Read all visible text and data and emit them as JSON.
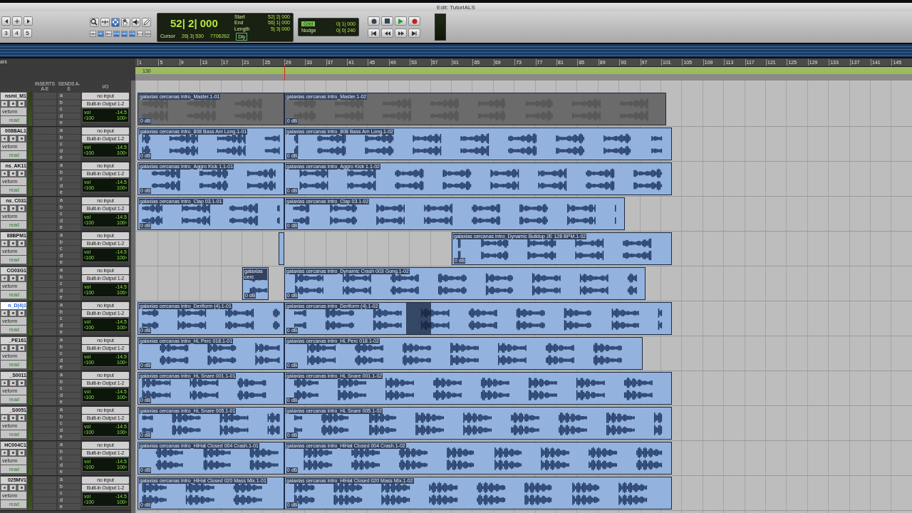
{
  "window": {
    "title": "Edit: TutorIALS"
  },
  "toolbar": {
    "zoom_presets": [
      "3",
      "4",
      "5"
    ],
    "counter": {
      "main": "52| 2| 000",
      "start_label": "Start",
      "start": "52| 2| 000",
      "end_label": "End",
      "end": "56| 1| 000",
      "length_label": "Length",
      "length": "5| 3| 000",
      "cursor_label": "Cursor",
      "cursor": "26| 3| 530",
      "sample": "7706262",
      "delay": "Dly"
    },
    "grid": {
      "grid_label": "Grid",
      "grid": "0| 1| 000",
      "nudge_label": "Nudge",
      "nudge": "0| 0| 240"
    }
  },
  "columns": {
    "inserts": "INSERTS A-E",
    "sends": "SENDS A-E",
    "io": "I/O"
  },
  "ruler": {
    "label": "ars",
    "tempo": "130",
    "bars": [
      "1",
      "5",
      "9",
      "13",
      "17",
      "21",
      "25",
      "29",
      "33",
      "37",
      "41",
      "45",
      "49",
      "53",
      "57",
      "61",
      "65",
      "69",
      "73",
      "77",
      "81",
      "85",
      "89",
      "93",
      "97",
      "101",
      "105",
      "109",
      "113",
      "117",
      "121",
      "125",
      "129",
      "133",
      "137",
      "141",
      "145"
    ]
  },
  "tracks": [
    {
      "name": "nsml_M1",
      "selected": false,
      "color": "#6b6b6b",
      "input": "no input",
      "output": "Built-in Output 1-2",
      "volume_label": "vol",
      "volume": "-14.5",
      "pan_left": "‹100",
      "pan_right": "100›",
      "view": "veform",
      "automation": "read",
      "sends": [
        "a",
        "b",
        "c",
        "d",
        "e"
      ],
      "clips": [
        {
          "name": "galaxias cercanas intro_Master.1-01",
          "gain": "0 dB"
        },
        {
          "name": "galaxias cercanas intro_Master.1-02",
          "gain": "0 dB"
        }
      ]
    },
    {
      "name": "008BAL1",
      "selected": false,
      "color": "#93b3de",
      "input": "no input",
      "output": "Built-in Output 1-2",
      "volume_label": "vol",
      "volume": "-14.5",
      "pan_left": "‹100",
      "pan_right": "100›",
      "view": "veform",
      "automation": "read",
      "sends": [
        "a",
        "b",
        "c",
        "d",
        "e"
      ],
      "clips": [
        {
          "name": "galaxias cercanas intro_808 Bass Am Long.1-01",
          "gain": "0 dB"
        },
        {
          "name": "galaxias cercanas intro_808 Bass Am Long.1-02",
          "gain": "0 dB"
        }
      ]
    },
    {
      "name": "ns_AK11",
      "selected": false,
      "color": "#93b3de",
      "input": "no input",
      "output": "Built-in Output 1-2",
      "volume_label": "vol",
      "volume": "-14.5",
      "pan_left": "‹100",
      "pan_right": "100›",
      "view": "veform",
      "automation": "read",
      "sends": [
        "a",
        "b",
        "c",
        "d",
        "e"
      ],
      "clips": [
        {
          "name": "galaxias cercanas intro_Aggro Kick 1.1-01",
          "gain": "0 dB"
        },
        {
          "name": "galaxias cercanas intro_Aggro Kick 1.1-02",
          "gain": "0 dB"
        }
      ]
    },
    {
      "name": "ns_C031",
      "selected": false,
      "color": "#93b3de",
      "input": "no input",
      "output": "Built-in Output 1-2",
      "volume_label": "vol",
      "volume": "-14.5",
      "pan_left": "‹100",
      "pan_right": "100›",
      "view": "veform",
      "automation": "read",
      "sends": [
        "a",
        "b",
        "c",
        "d",
        "e"
      ],
      "clips": [
        {
          "name": "galaxias cercanas intro_Clap 03.1-01",
          "gain": "0 dB"
        },
        {
          "name": "galaxias cercanas intro_Clap 03.1-02",
          "gain": "0 dB"
        }
      ]
    },
    {
      "name": "88BPM1",
      "selected": false,
      "color": "#93b3de",
      "input": "no input",
      "output": "Built-in Output 1-2",
      "volume_label": "vol",
      "volume": "-14.5",
      "pan_left": "‹100",
      "pan_right": "100›",
      "view": "veform",
      "automation": "read",
      "sends": [
        "a",
        "b",
        "c",
        "d",
        "e"
      ],
      "clips": [
        {
          "name": "galaxias cercanas intro_Dynamic Buildup 2E 128 BPM.1-02",
          "gain": "0 dB"
        }
      ]
    },
    {
      "name": "CO03G1",
      "selected": false,
      "color": "#93b3de",
      "input": "no input",
      "output": "Built-in Output 1-2",
      "volume_label": "vol",
      "volume": "-14.5",
      "pan_left": "‹100",
      "pan_right": "100›",
      "view": "veform",
      "automation": "read",
      "sends": [
        "a",
        "b",
        "c",
        "d",
        "e"
      ],
      "clips": [
        {
          "name": "galaxias cerc",
          "gain": "0 dB"
        },
        {
          "name": "galaxias cercanas intro_Dynamic Crash 003 Gong.1-02",
          "gain": "0 dB"
        }
      ]
    },
    {
      "name": "n_D(4)1",
      "selected": true,
      "color": "#93b3de",
      "input": "no input",
      "output": "Built-in Output 1-2",
      "volume_label": "vol",
      "volume": "-14.5",
      "pan_left": "‹100",
      "pan_right": "100›",
      "view": "veform",
      "automation": "read",
      "sends": [
        "a",
        "b",
        "c",
        "d",
        "e"
      ],
      "clips": [
        {
          "name": "galaxias cercanas intro_Deriform (4).1-01",
          "gain": "0 dB"
        },
        {
          "name": "galaxias cercanas intro_Deriform (4).1-02",
          "gain": "0 dB"
        }
      ]
    },
    {
      "name": "_PE161",
      "selected": false,
      "color": "#93b3de",
      "input": "no input",
      "output": "Built-in Output 1-2",
      "volume_label": "vol",
      "volume": "-14.5",
      "pan_left": "‹100",
      "pan_right": "100›",
      "view": "veform",
      "automation": "read",
      "sends": [
        "a",
        "b",
        "c",
        "d",
        "e"
      ],
      "clips": [
        {
          "name": "galaxias cercanas intro_HL Perc 018.1-01",
          "gain": "0 dB"
        },
        {
          "name": "galaxias cercanas intro_HL Perc 018.1-02",
          "gain": "0 dB"
        }
      ]
    },
    {
      "name": "_S0011",
      "selected": false,
      "color": "#93b3de",
      "input": "no input",
      "output": "Built-in Output 1-2",
      "volume_label": "vol",
      "volume": "-14.5",
      "pan_left": "‹100",
      "pan_right": "100›",
      "view": "veform",
      "automation": "read",
      "sends": [
        "a",
        "b",
        "c",
        "d",
        "e"
      ],
      "clips": [
        {
          "name": "galaxias cercanas intro_HL Snare 001.1-01",
          "gain": "0 dB"
        },
        {
          "name": "galaxias cercanas intro_HL Snare 001.1-02",
          "gain": "0 dB"
        }
      ]
    },
    {
      "name": "_S0051",
      "selected": false,
      "color": "#93b3de",
      "input": "no input",
      "output": "Built-in Output 1-2",
      "volume_label": "vol",
      "volume": "-14.5",
      "pan_left": "‹100",
      "pan_right": "100›",
      "view": "veform",
      "automation": "read",
      "sends": [
        "a",
        "b",
        "c",
        "d",
        "e"
      ],
      "clips": [
        {
          "name": "galaxias cercanas intro_HL Snare 005.1-01",
          "gain": "0 dB"
        },
        {
          "name": "galaxias cercanas intro_HL Snare 005.1-02",
          "gain": "0 dB"
        }
      ]
    },
    {
      "name": "HC004C1",
      "selected": false,
      "color": "#93b3de",
      "input": "no input",
      "output": "Built-in Output 1-2",
      "volume_label": "vol",
      "volume": "-14.5",
      "pan_left": "‹100",
      "pan_right": "100›",
      "view": "veform",
      "automation": "read",
      "sends": [
        "a",
        "b",
        "c",
        "d",
        "e"
      ],
      "clips": [
        {
          "name": "galaxias cercanas intro_HiHat Closed 004 Crash.1-01",
          "gain": "0 dB"
        },
        {
          "name": "galaxias cercanas intro_HiHat Closed 004 Crash.1-02",
          "gain": "0 dB"
        }
      ]
    },
    {
      "name": "025MV1",
      "selected": false,
      "color": "#93b3de",
      "input": "no input",
      "output": "Built-in Output 1-2",
      "volume_label": "vol",
      "volume": "-14.5",
      "pan_left": "‹100",
      "pan_right": "100›",
      "view": "veform",
      "automation": "read",
      "sends": [
        "a",
        "b",
        "c",
        "d",
        "e"
      ],
      "clips": [
        {
          "name": "galaxias cercanas intro_HiHat Closed 020 Mass Mix.1-01",
          "gain": "0 dB"
        },
        {
          "name": "galaxias cercanas intro_HiHat Closed 020 Mass Mix.1-02",
          "gain": "0 dB"
        }
      ]
    }
  ]
}
